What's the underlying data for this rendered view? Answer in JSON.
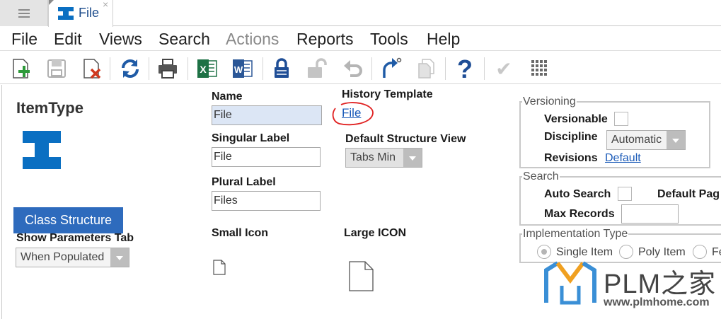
{
  "tab": {
    "label": "File",
    "close": "×"
  },
  "menu": {
    "file": "File",
    "edit": "Edit",
    "views": "Views",
    "search": "Search",
    "actions": "Actions",
    "reports": "Reports",
    "tools": "Tools",
    "help": "Help"
  },
  "toolbar": {
    "icons": [
      "new-icon",
      "save-icon",
      "delete-icon",
      "refresh-icon",
      "print-icon",
      "excel-icon",
      "word-icon",
      "lock-icon",
      "unlock-icon",
      "undo-icon",
      "promote-icon",
      "copy-icon",
      "help-icon",
      "done-icon",
      "grid-icon"
    ],
    "excel_letter": "X",
    "word_letter": "W",
    "help_glyph": "?",
    "done_glyph": "✔"
  },
  "itemtype": {
    "title": "ItemType"
  },
  "form": {
    "name_label": "Name",
    "name_value": "File",
    "singular_label": "Singular Label",
    "singular_value": "File",
    "plural_label": "Plural Label",
    "plural_value": "Files",
    "history_label": "History Template",
    "history_link": "File",
    "default_view_label": "Default Structure View",
    "default_view_value": "Tabs Min",
    "small_icon_label": "Small Icon",
    "large_icon_label": "Large ICON"
  },
  "class_structure_button": "Class Structure",
  "show_params": {
    "label": "Show Parameters Tab",
    "value": "When Populated"
  },
  "versioning": {
    "legend": "Versioning",
    "versionable_label": "Versionable",
    "discipline_label": "Discipline",
    "discipline_value": "Automatic",
    "revisions_label": "Revisions",
    "revisions_link": "Default"
  },
  "search": {
    "legend": "Search",
    "auto_search_label": "Auto Search",
    "default_page_label": "Default Pag",
    "max_records_label": "Max Records",
    "max_records_value": ""
  },
  "implementation": {
    "legend": "Implementation Type",
    "options": [
      "Single Item",
      "Poly Item",
      "Fe"
    ],
    "selected": "Single Item"
  },
  "watermark": {
    "brand": "PLM之家",
    "url": "www.plmhome.com"
  },
  "colors": {
    "brand_blue": "#0a6fc2",
    "link": "#1a5ab8",
    "button": "#2e6bbd",
    "watermark_blue": "#3a8fd6",
    "watermark_orange": "#f0a020"
  }
}
